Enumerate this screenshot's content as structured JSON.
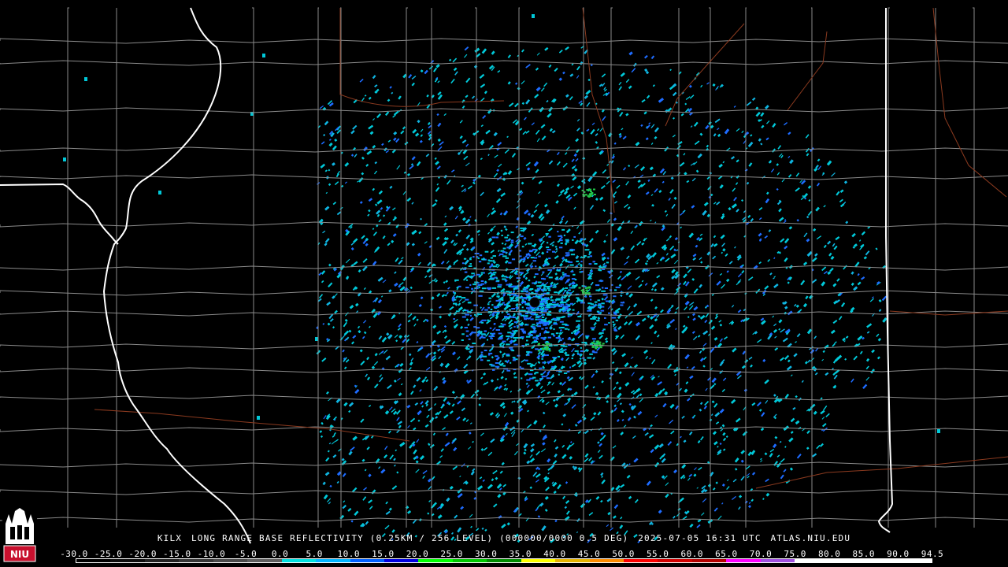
{
  "caption": {
    "station": "KILX",
    "product": "LONG RANGE BASE REFLECTIVITY (0.25KM / 256 LEVEL) (000000/0000 0.5 DEG)",
    "timestamp": "2025-07-05 16:31 UTC",
    "source": "ATLAS.NIU.EDU"
  },
  "logo": {
    "text": "NIU"
  },
  "scale": {
    "labels": [
      "-30.0",
      "-25.0",
      "-20.0",
      "-15.0",
      "-10.0",
      "-5.0",
      "0.0",
      "5.0",
      "10.0",
      "15.0",
      "20.0",
      "25.0",
      "30.0",
      "35.0",
      "40.0",
      "45.0",
      "50.0",
      "55.0",
      "60.0",
      "65.0",
      "70.0",
      "75.0",
      "80.0",
      "85.0",
      "90.0",
      "94.5"
    ],
    "colors": [
      "#000000",
      "#0e0e0e",
      "#222222",
      "#363636",
      "#4a4a4a",
      "#5e5e5e",
      "#00e0e0",
      "#00b4ff",
      "#0060ff",
      "#0000e0",
      "#00ff00",
      "#00c800",
      "#008c00",
      "#ffff00",
      "#e6b400",
      "#ff8c00",
      "#ff0000",
      "#d20000",
      "#b40000",
      "#ff00ff",
      "#a050e0",
      "#ffffff",
      "#ffffff",
      "#ffffff",
      "#ffffff"
    ]
  },
  "colors": {
    "background": "#000000",
    "county_lines": "#8a8a8a",
    "state_lines": "#ffffff",
    "highways": "#8b3a1f",
    "echo_primary": "#00c8d8",
    "echo_secondary": "#1e6cff",
    "echo_strong": "#22c84a"
  }
}
